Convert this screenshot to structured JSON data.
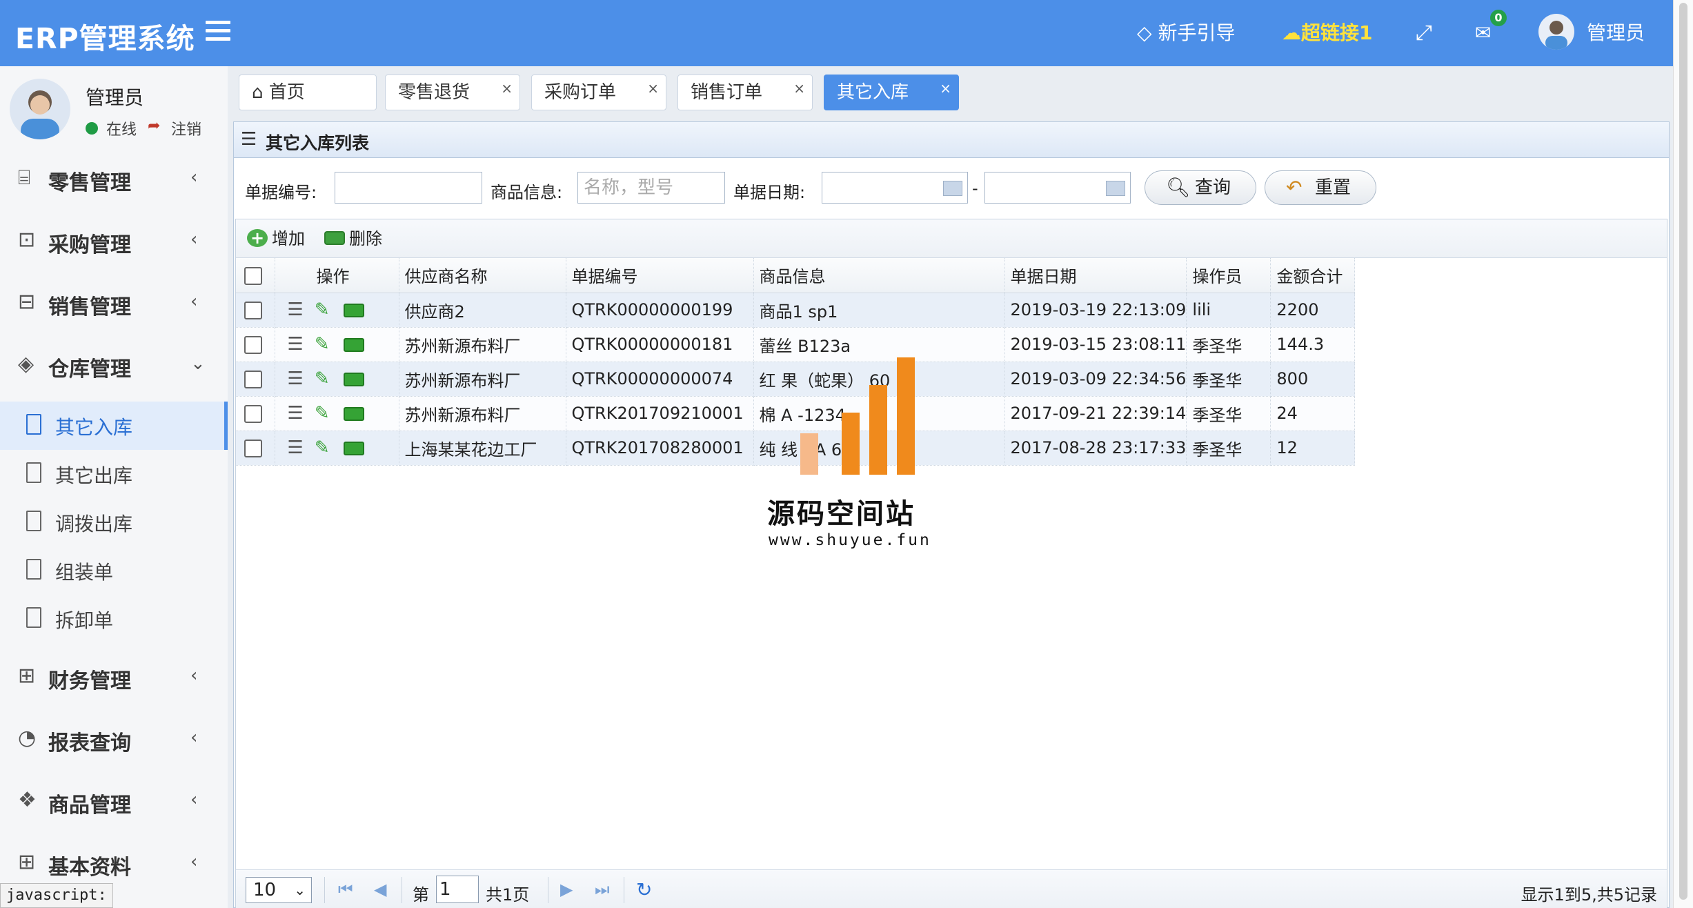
{
  "header": {
    "logo": "ERP管理系统",
    "guide": "新手引导",
    "hyperlink": "超链接1",
    "mail_badge": "0",
    "user": "管理员",
    "colors": {
      "bar": "#4c8fe8",
      "hyperlink": "#ffe23c",
      "badge": "#24a04a"
    },
    "icons": [
      "menu-icon",
      "diamond-icon",
      "cloud-icon",
      "fullscreen-icon",
      "mail-icon",
      "avatar"
    ]
  },
  "sidebar": {
    "user": {
      "name": "管理员",
      "status": "在线",
      "logout": "注销"
    },
    "menu": [
      {
        "label": "零售管理",
        "icon": "gift-icon"
      },
      {
        "label": "采购管理",
        "icon": "cart-icon"
      },
      {
        "label": "销售管理",
        "icon": "briefcase-icon"
      },
      {
        "label": "仓库管理",
        "icon": "layers-icon",
        "expanded": true
      },
      {
        "label": "财务管理",
        "icon": "book-icon"
      },
      {
        "label": "报表查询",
        "icon": "pie-icon"
      },
      {
        "label": "商品管理",
        "icon": "cubes-icon"
      },
      {
        "label": "基本资料",
        "icon": "grid-icon"
      }
    ],
    "submenu": [
      {
        "label": "其它入库",
        "active": true
      },
      {
        "label": "其它出库"
      },
      {
        "label": "调拨出库"
      },
      {
        "label": "组装单"
      },
      {
        "label": "拆卸单"
      }
    ]
  },
  "status_bar": "javascript:",
  "tabs": [
    {
      "label": "首页",
      "closable": false
    },
    {
      "label": "零售退货",
      "closable": true
    },
    {
      "label": "采购订单",
      "closable": true
    },
    {
      "label": "销售订单",
      "closable": true
    },
    {
      "label": "其它入库",
      "closable": true,
      "active": true
    }
  ],
  "panel": {
    "title": "其它入库列表",
    "search": {
      "bill_no_label": "单据编号:",
      "goods_label": "商品信息:",
      "goods_placeholder": "名称，型号",
      "date_label": "单据日期:",
      "date_separator": "-",
      "query_button": "查询",
      "reset_button": "重置"
    },
    "toolbar": {
      "add": "增加",
      "delete": "删除"
    },
    "columns": [
      "操作",
      "供应商名称",
      "单据编号",
      "商品信息",
      "单据日期",
      "操作员",
      "金额合计"
    ],
    "rows": [
      {
        "supplier": "供应商2",
        "bill_no": "QTRK00000000199",
        "goods": "商品1 sp1",
        "date": "2019-03-19 22:13:09",
        "operator": "lili",
        "amount": "2200"
      },
      {
        "supplier": "苏州新源布料厂",
        "bill_no": "QTRK00000000181",
        "goods": "蕾丝 B123a",
        "date": "2019-03-15 23:08:11",
        "operator": "季圣华",
        "amount": "144.3"
      },
      {
        "supplier": "苏州新源布料厂",
        "bill_no": "QTRK00000000074",
        "goods": "红   果（蛇果） 60",
        "date": "2019-03-09 22:34:56",
        "operator": "季圣华",
        "amount": "800"
      },
      {
        "supplier": "苏州新源布料厂",
        "bill_no": "QTRK201709210001",
        "goods": "棉    A   -1234",
        "date": "2017-09-21 22:39:14",
        "operator": "季圣华",
        "amount": "24"
      },
      {
        "supplier": "上海某某花边工厂",
        "bill_no": "QTRK201708280001",
        "goods": "纯   线 AA   6",
        "date": "2017-08-28 23:17:33",
        "operator": "季圣华",
        "amount": "12"
      }
    ],
    "pager": {
      "page_size": "10",
      "page_prefix": "第",
      "current_page": "1",
      "page_total": "共1页",
      "record_info": "显示1到5,共5记录"
    }
  },
  "watermark": {
    "title": "源码空间站",
    "url": "www.shuyue.fun",
    "color": "#f08a1c"
  }
}
